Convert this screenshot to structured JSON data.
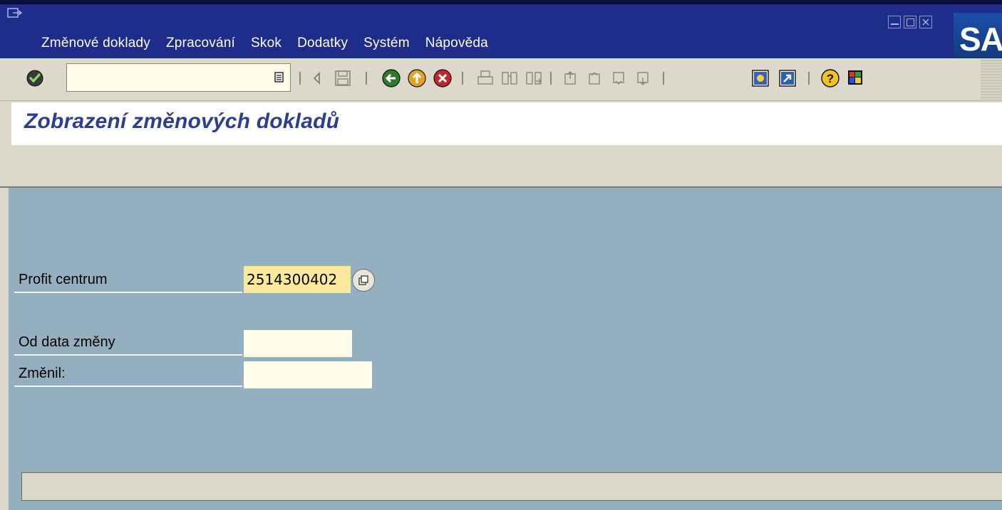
{
  "menu": {
    "items": [
      {
        "label": "Změnové doklady"
      },
      {
        "label": "Zpracování"
      },
      {
        "label": "Skok"
      },
      {
        "label": "Dodatky"
      },
      {
        "label": "Systém"
      },
      {
        "label": "Nápověda"
      }
    ]
  },
  "logo": {
    "text": "SA"
  },
  "toolbar": {
    "command_field_value": "",
    "icons": [
      "enter-icon",
      "back-arrow-icon",
      "save-icon",
      "back-icon",
      "exit-icon",
      "cancel-icon",
      "print-icon",
      "find-icon",
      "find-next-icon",
      "first-page-icon",
      "previous-page-icon",
      "next-page-icon",
      "last-page-icon",
      "create-session-icon",
      "shortcut-icon",
      "help-icon",
      "layout-menu-icon"
    ]
  },
  "header": {
    "title": "Zobrazení změnových dokladů"
  },
  "form": {
    "profit_center": {
      "label": "Profit centrum",
      "value": "2514300402"
    },
    "date_from": {
      "label": "Od data změny",
      "value": ""
    },
    "changed_by": {
      "label": "Změnil:",
      "value": ""
    }
  },
  "colors": {
    "title_bar": "#1e2c8a",
    "title_text": "#2b3e8f",
    "canvas": "#94b0c0",
    "key_field": "#fbe99b"
  }
}
